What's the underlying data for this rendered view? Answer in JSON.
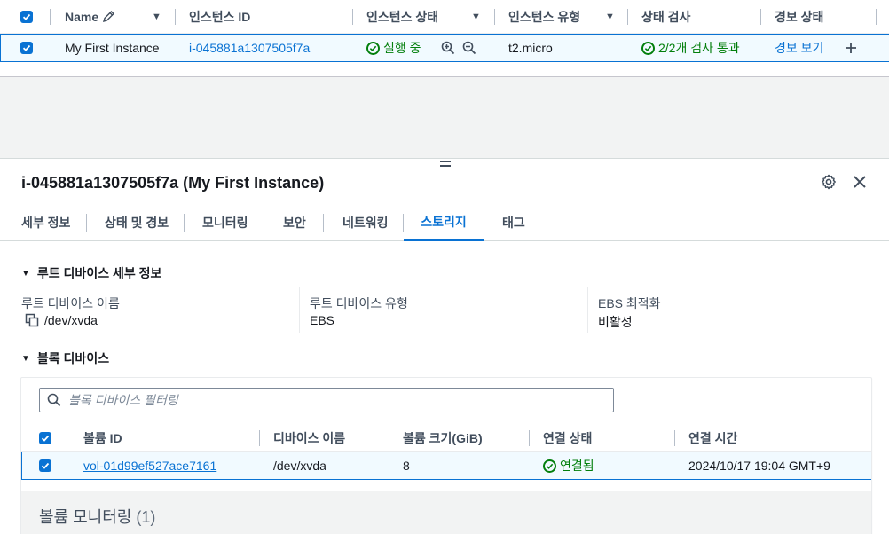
{
  "instance_table": {
    "headers": {
      "name": "Name",
      "instance_id": "인스턴스 ID",
      "instance_state": "인스턴스 상태",
      "instance_type": "인스턴스 유형",
      "status_check": "상태 검사",
      "alarm_status": "경보 상태"
    },
    "row": {
      "name": "My First Instance",
      "instance_id": "i-045881a1307505f7a",
      "instance_state": "실행 중",
      "instance_type": "t2.micro",
      "status_check": "2/2개 검사 통과",
      "alarm_status": "경보 보기"
    }
  },
  "split_panel": {
    "title": "i-045881a1307505f7a (My First Instance)",
    "tabs": [
      "세부 정보",
      "상태 및 경보",
      "모니터링",
      "보안",
      "네트워킹",
      "스토리지",
      "태그"
    ],
    "active_tab": "스토리지",
    "root_device": {
      "section_title": "루트 디바이스 세부 정보",
      "name_label": "루트 디바이스 이름",
      "name_value": "/dev/xvda",
      "type_label": "루트 디바이스 유형",
      "type_value": "EBS",
      "ebs_label": "EBS 최적화",
      "ebs_value": "비활성"
    },
    "block_devices": {
      "section_title": "블록 디바이스",
      "filter_placeholder": "블록 디바이스 필터링",
      "headers": {
        "volume_id": "볼륨 ID",
        "device_name": "디바이스 이름",
        "volume_size": "볼륨 크기(GiB)",
        "attach_state": "연결 상태",
        "attach_time": "연결 시간"
      },
      "row": {
        "volume_id": "vol-01d99ef527ace7161",
        "device_name": "/dev/xvda",
        "volume_size": "8",
        "attach_state": "연결됨",
        "attach_time": "2024/10/17 19:04 GMT+9"
      }
    },
    "volume_monitoring": {
      "title": "볼륨 모니터링",
      "count": "(1)"
    }
  },
  "colors": {
    "accent": "#0972d3",
    "success": "#037f0c",
    "selected_row_bg": "#f1faff"
  }
}
